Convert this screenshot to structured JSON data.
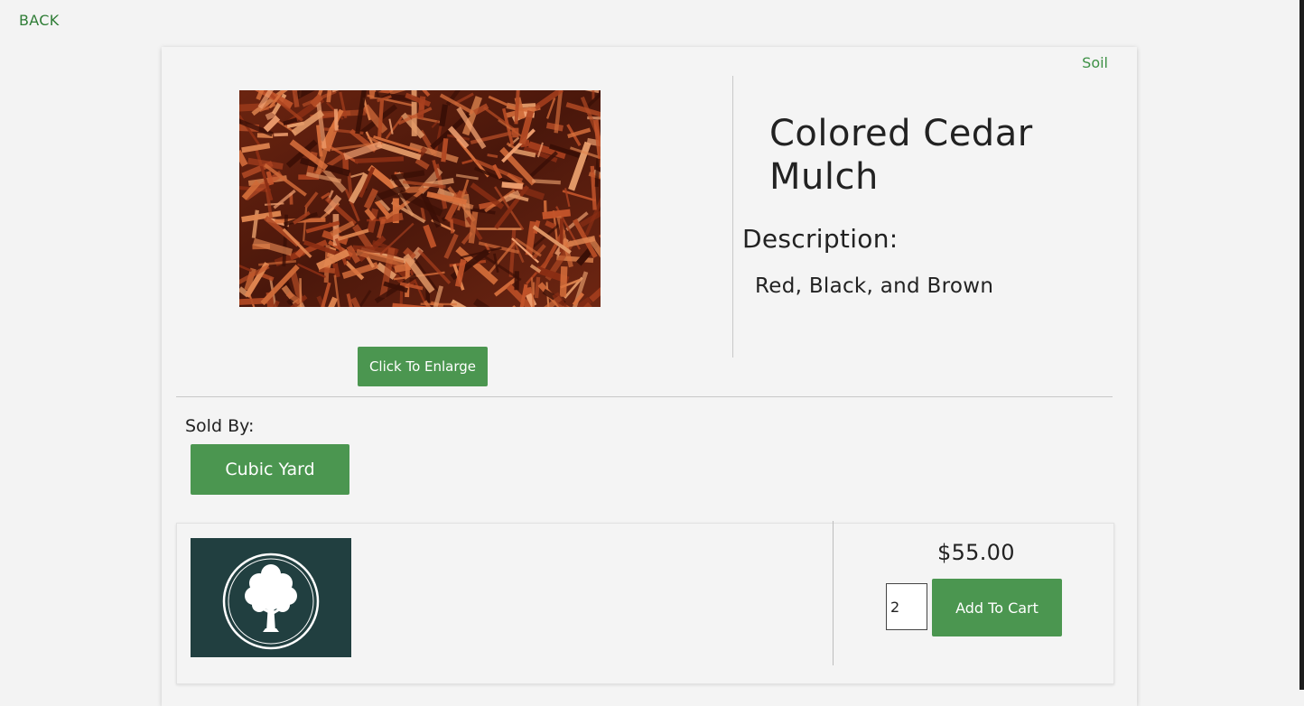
{
  "nav": {
    "back_label": "BACK"
  },
  "product": {
    "category": "Soil",
    "title": "Colored Cedar Mulch",
    "description_heading": "Description:",
    "description": "Red, Black, and Brown",
    "enlarge_label": "Click To Enlarge",
    "image_subject": "cedar-mulch-photo"
  },
  "sold_by": {
    "label": "Sold By:",
    "unit_label": "Cubic Yard"
  },
  "purchase": {
    "price": "$55.00",
    "quantity": "2",
    "add_to_cart_label": "Add To Cart"
  },
  "seller": {
    "logo_icon": "tree-logo-icon"
  },
  "colors": {
    "accent_green": "#4b9650",
    "link_green": "#2f7d36",
    "logo_bg": "#213f40",
    "page_bg": "#f3f3f3"
  }
}
